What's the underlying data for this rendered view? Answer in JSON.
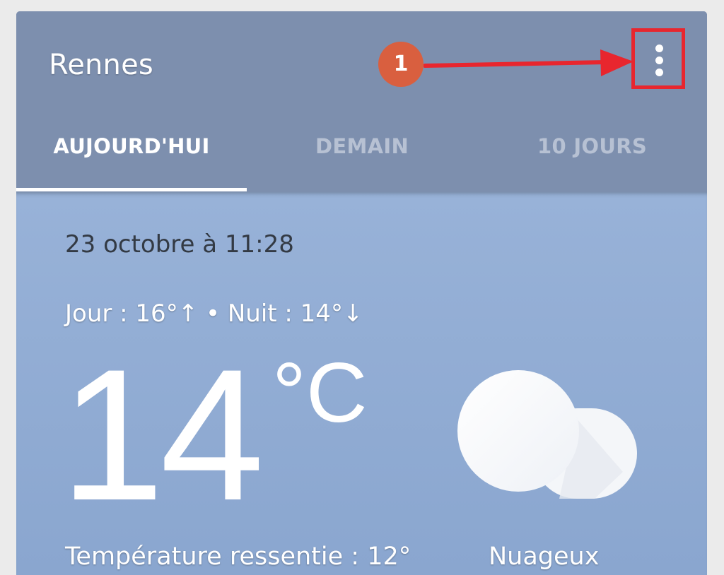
{
  "header": {
    "city": "Rennes",
    "menu_icon": "more-vertical-icon"
  },
  "tabs": [
    {
      "label": "AUJOURD'HUI",
      "selected": true
    },
    {
      "label": "DEMAIN",
      "selected": false
    },
    {
      "label": "10 JOURS",
      "selected": false
    }
  ],
  "weather": {
    "datetime": "23 octobre à 11:28",
    "day_night": "Jour : 16°↑ • Nuit : 14°↓",
    "temperature": "14",
    "unit": "°C",
    "condition_icon": "cloud-icon",
    "feels_like": "Température ressentie : 12°",
    "condition": "Nuageux"
  },
  "annotation": {
    "badge": "1",
    "color": "#e8262e",
    "badge_color": "#d95f3f"
  },
  "colors": {
    "header_bg": "#7d8fae",
    "body_bg": "#98b2d8",
    "tab_inactive": "#b7c1d3"
  }
}
